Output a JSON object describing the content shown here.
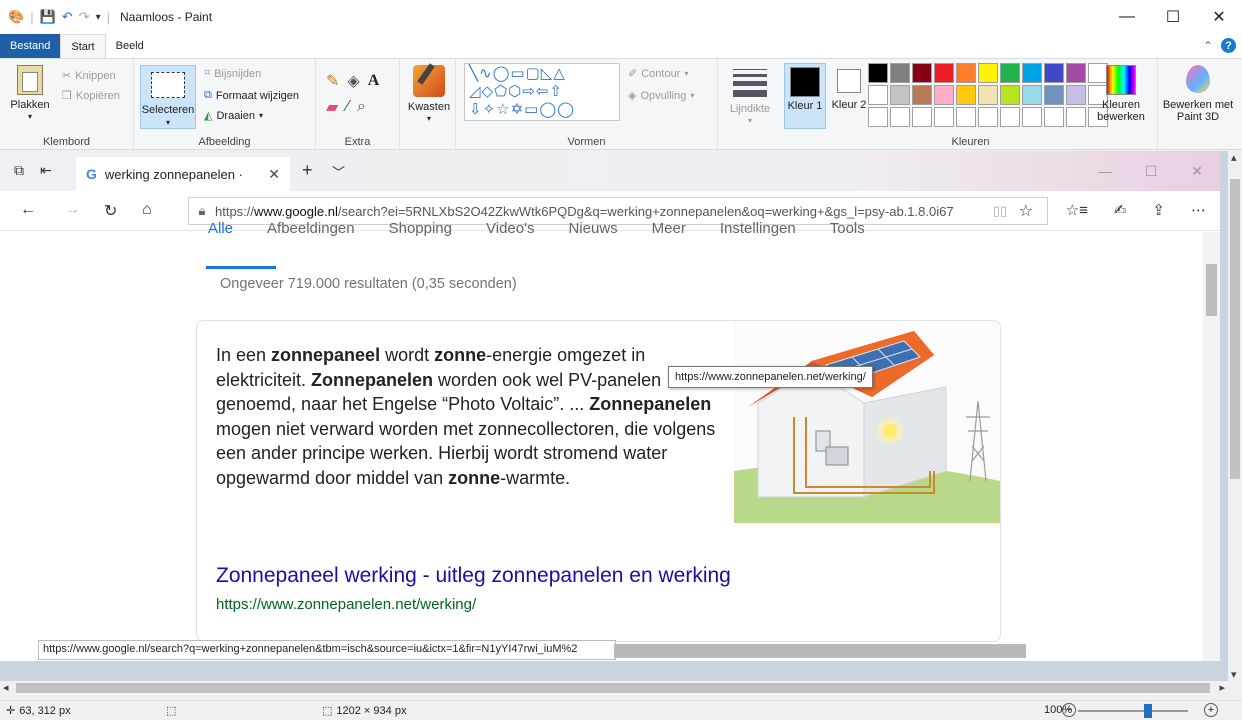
{
  "titlebar": {
    "title": "Naamloos - Paint",
    "controls": {
      "minimize": "—",
      "maximize": "☐",
      "close": "✕"
    }
  },
  "ribbon_tabs": {
    "file": "Bestand",
    "start": "Start",
    "view": "Beeld"
  },
  "ribbon": {
    "clipboard": {
      "paste": "Plakken",
      "cut": "Knippen",
      "copy": "Kopiëren",
      "label": "Klembord"
    },
    "image": {
      "select": "Selecteren",
      "crop": "Bijsnijden",
      "resize": "Formaat wijzigen",
      "rotate": "Draaien",
      "label": "Afbeelding"
    },
    "tools": {
      "label": "Extra"
    },
    "brushes": {
      "label": "Kwasten"
    },
    "shapes": {
      "outline": "Contour",
      "fill": "Opvulling",
      "label": "Vormen"
    },
    "size": {
      "label": "Lijndikte"
    },
    "colors": {
      "color1": "Kleur 1",
      "color2": "Kleur 2",
      "color1_value": "#000000",
      "color2_value": "#ffffff",
      "edit": "Kleuren bewerken",
      "paint3d": "Bewerken met Paint 3D",
      "label": "Kleuren",
      "palette": [
        "#000000",
        "#7f7f7f",
        "#880015",
        "#ed1c24",
        "#ff7f27",
        "#fff200",
        "#22b14c",
        "#00a2e8",
        "#3f48cc",
        "#a349a4",
        "#ffffff",
        "#c3c3c3",
        "#b97a57",
        "#ffaec9",
        "#ffc90e",
        "#efe4b0",
        "#b5e61d",
        "#99d9ea",
        "#7092be",
        "#c8bfe7"
      ]
    }
  },
  "edge": {
    "tab_title": "werking zonnepanelen ·",
    "url_prefix": "https://",
    "url_host": "www.google.nl",
    "url_rest": "/search?ei=5RNLXbS2O42ZkwWtk6PQDg&q=werking+zonnepanelen&oq=werking+&gs_l=psy-ab.1.8.0i67",
    "search_tabs": [
      "Alle",
      "Afbeeldingen",
      "Shopping",
      "Video's",
      "Nieuws",
      "Meer",
      "Instellingen",
      "Tools"
    ],
    "results_count": "Ongeveer 719.000 resultaten (0,35 seconden)",
    "snippet_html": "In een <b>zonnepaneel</b> wordt <b>zonne</b>-energie omgezet in elektriciteit. <b>Zonnepanelen</b> worden ook wel PV-panelen genoemd, naar het Engelse “Photo Voltaic”. ... <b>Zonnepanelen</b> mogen niet verward worden met zonnecollectoren, die volgens een ander principe werken. Hierbij wordt stromend water opgewarmd door middel van <b>zonne</b>-warmte.",
    "result_title": "Zonnepaneel werking - uitleg zonnepanelen en werking",
    "result_url": "https://www.zonnepanelen.net/werking/",
    "tooltip": "https://www.zonnepanelen.net/werking/",
    "status_url": "https://www.google.nl/search?q=werking+zonnepanelen&tbm=isch&source=iu&ictx=1&fir=N1yYI47rwi_iuM%2"
  },
  "statusbar": {
    "cursor": "63, 312 px",
    "image_size": "1202 × 934 px",
    "zoom": "100%"
  }
}
